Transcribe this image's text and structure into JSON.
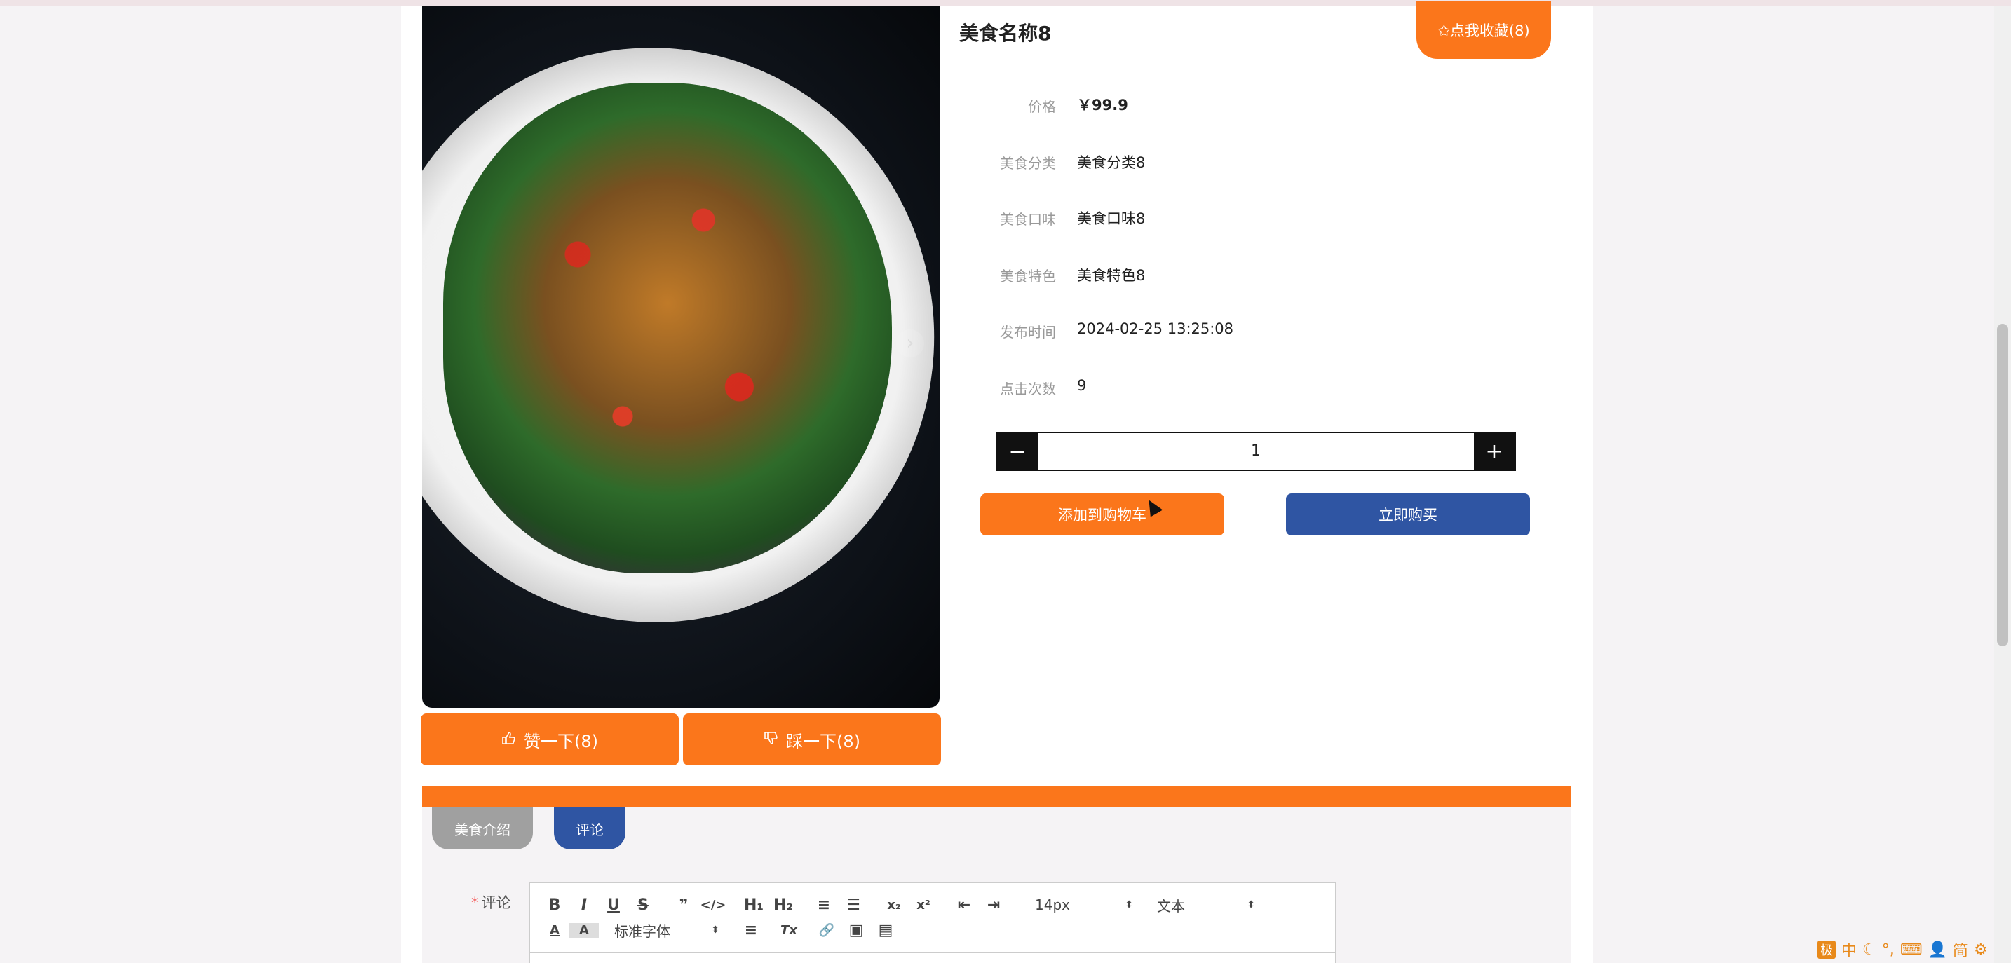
{
  "product": {
    "name": "美食名称8",
    "favorite_label": "✩点我收藏(8)",
    "attributes": [
      {
        "label": "价格",
        "value": "￥99.9"
      },
      {
        "label": "美食分类",
        "value": "美食分类8"
      },
      {
        "label": "美食口味",
        "value": "美食口味8"
      },
      {
        "label": "美食特色",
        "value": "美食特色8"
      },
      {
        "label": "发布时间",
        "value": "2024-02-25 13:25:08"
      },
      {
        "label": "点击次数",
        "value": "9"
      }
    ]
  },
  "gallery": {
    "next_arrow": "›"
  },
  "votes": {
    "like_label": "赞一下(8)",
    "dislike_label": "踩一下(8)"
  },
  "quantity": {
    "minus": "−",
    "value": "1",
    "plus": "+"
  },
  "actions": {
    "add_cart_label": "添加到购物车",
    "buy_now_label": "立即购买"
  },
  "tabs": [
    {
      "label": "美食介绍",
      "active": false
    },
    {
      "label": "评论",
      "active": true
    }
  ],
  "comment": {
    "required_mark": "*",
    "label": "评论",
    "toolbar": {
      "bold": "B",
      "italic": "I",
      "underline": "U",
      "strike": "S",
      "quote": "❞",
      "code": "</>",
      "h1": "H₁",
      "h2": "H₂",
      "ordered_list": "≡",
      "bullet_list": "☰",
      "subscript": "x₂",
      "superscript": "x²",
      "outdent": "⇤",
      "indent": "⇥",
      "font_size": "14px",
      "block_type": "文本",
      "font_color": "A",
      "background": "A",
      "font_family": "标准字体",
      "align": "≡",
      "clean": "Tx",
      "link": "🔗",
      "image": "▣",
      "video": "▤"
    }
  },
  "ime": {
    "logo": "极",
    "lang": "中",
    "moon": "☾",
    "dots": "°,",
    "keyboard": "⌨",
    "user": "👤",
    "simp": "简",
    "gear": "⚙"
  },
  "colors": {
    "accent_orange": "#fb761b",
    "accent_blue": "#2f55a3",
    "tab_gray": "#a0a0a0"
  }
}
